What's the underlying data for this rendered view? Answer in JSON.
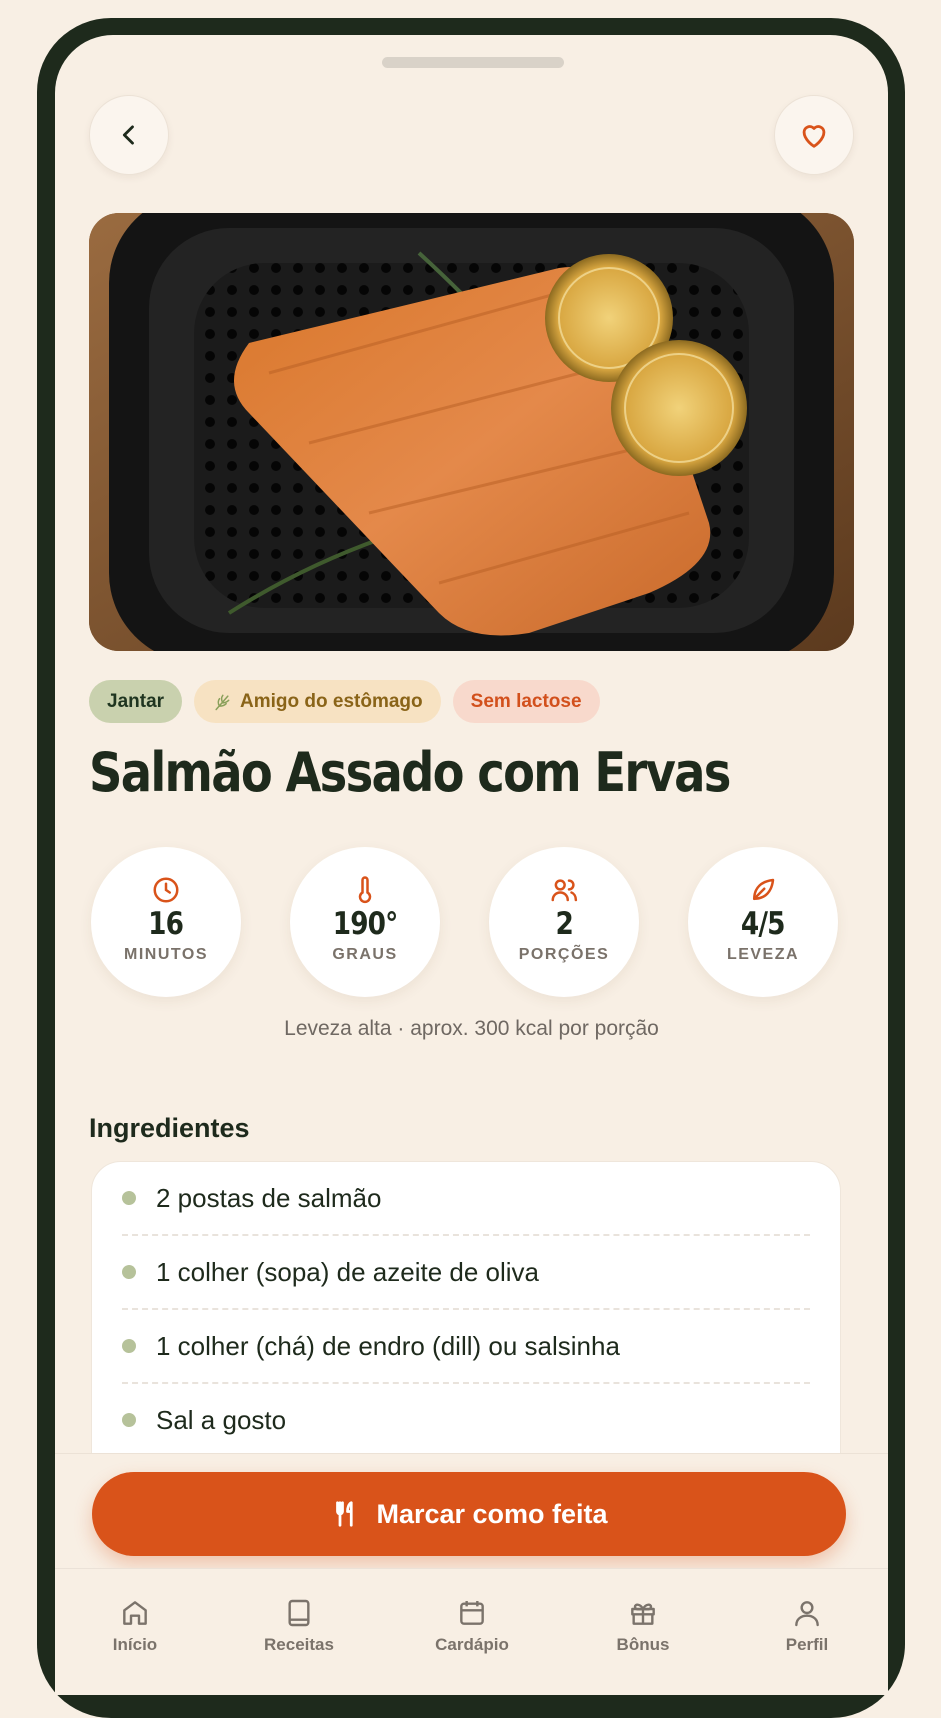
{
  "recipe": {
    "title": "Salmão Assado com Ervas",
    "image_alt": "salmão assado com ervas e limão na air fryer",
    "tags": [
      {
        "label": "Jantar",
        "icon": "none"
      },
      {
        "label": "Amigo do estômago",
        "icon": "herb-icon"
      },
      {
        "label": "Sem lactose",
        "icon": "none"
      }
    ],
    "stats": [
      {
        "value": "16",
        "label": "MINUTOS",
        "icon": "clock-icon"
      },
      {
        "value": "190°",
        "label": "GRAUS",
        "icon": "thermometer-icon"
      },
      {
        "value": "2",
        "label": "PORÇÕES",
        "icon": "users-icon"
      },
      {
        "value": "4/5",
        "label": "LEVEZA",
        "icon": "leaf-icon"
      }
    ],
    "note": "Leveza alta · aprox. 300 kcal por porção"
  },
  "ingredients": {
    "heading": "Ingredientes",
    "items": [
      "2 postas de salmão",
      "1 colher (sopa) de azeite de oliva",
      "1 colher (chá) de endro (dill) ou salsinha",
      "Sal a gosto"
    ]
  },
  "cta": {
    "label": "Marcar como feita",
    "icon": "utensils-icon"
  },
  "tabbar": {
    "items": [
      {
        "label": "Início",
        "icon": "home-icon"
      },
      {
        "label": "Receitas",
        "icon": "book-icon"
      },
      {
        "label": "Cardápio",
        "icon": "calendar-icon"
      },
      {
        "label": "Bônus",
        "icon": "gift-icon"
      },
      {
        "label": "Perfil",
        "icon": "user-icon"
      }
    ]
  },
  "colors": {
    "accent": "#d9531a",
    "dark": "#1e2a1c",
    "background": "#f8efe4"
  }
}
